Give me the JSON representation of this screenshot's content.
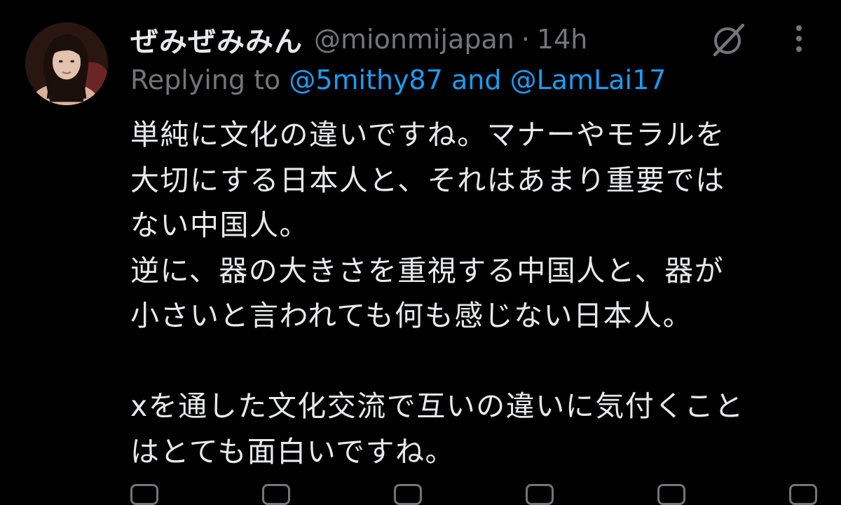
{
  "tweet": {
    "display_name": "ぜみぜみみん",
    "handle": "@mionmijapan",
    "separator": "·",
    "time": "14h",
    "reply": {
      "prefix": "Replying to",
      "mention_1": "@5mithy87",
      "conjunction": "and",
      "mention_2": "@LamLai17"
    },
    "body_lines": [
      "単純に文化の違いですね。マナーやモラルを",
      "大切にする日本人と、それはあまり重要では",
      "ない中国人。",
      "逆に、器の大きさを重視する中国人と、器が",
      "小さいと言われても何も感じない日本人。",
      "",
      "xを通した文化交流で互いの違いに気付くこと",
      "はとても面白いですね。"
    ],
    "icons": {
      "avatar": "avatar",
      "grok": "grok-icon",
      "more": "more-icon"
    }
  },
  "colors": {
    "background": "#000000",
    "text_primary": "#e7e9ea",
    "text_secondary": "#71767b",
    "link": "#1d9bf0"
  }
}
